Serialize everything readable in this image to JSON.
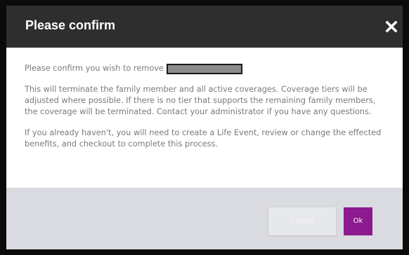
{
  "dialog": {
    "title": "Please confirm",
    "close_icon": "close-x-icon",
    "confirm_prefix": "Please confirm you wish to remove",
    "paragraph_1": "This will terminate the family member and all active coverages. Coverage tiers will be adjusted where possible. If there is no tier that supports the remaining family members, the coverage will be terminated. Contact your administrator if you have any questions.",
    "paragraph_2": "If you already haven't, you will need to create a Life Event, review or change the effected benefits, and checkout to complete this process.",
    "cancel_label": "Cancel",
    "ok_label": "Ok"
  },
  "colors": {
    "header_bg": "#2e2e2e",
    "footer_bg": "#dadbe0",
    "ok_button": "#8d1a8f",
    "body_text": "#7a7a7a"
  }
}
